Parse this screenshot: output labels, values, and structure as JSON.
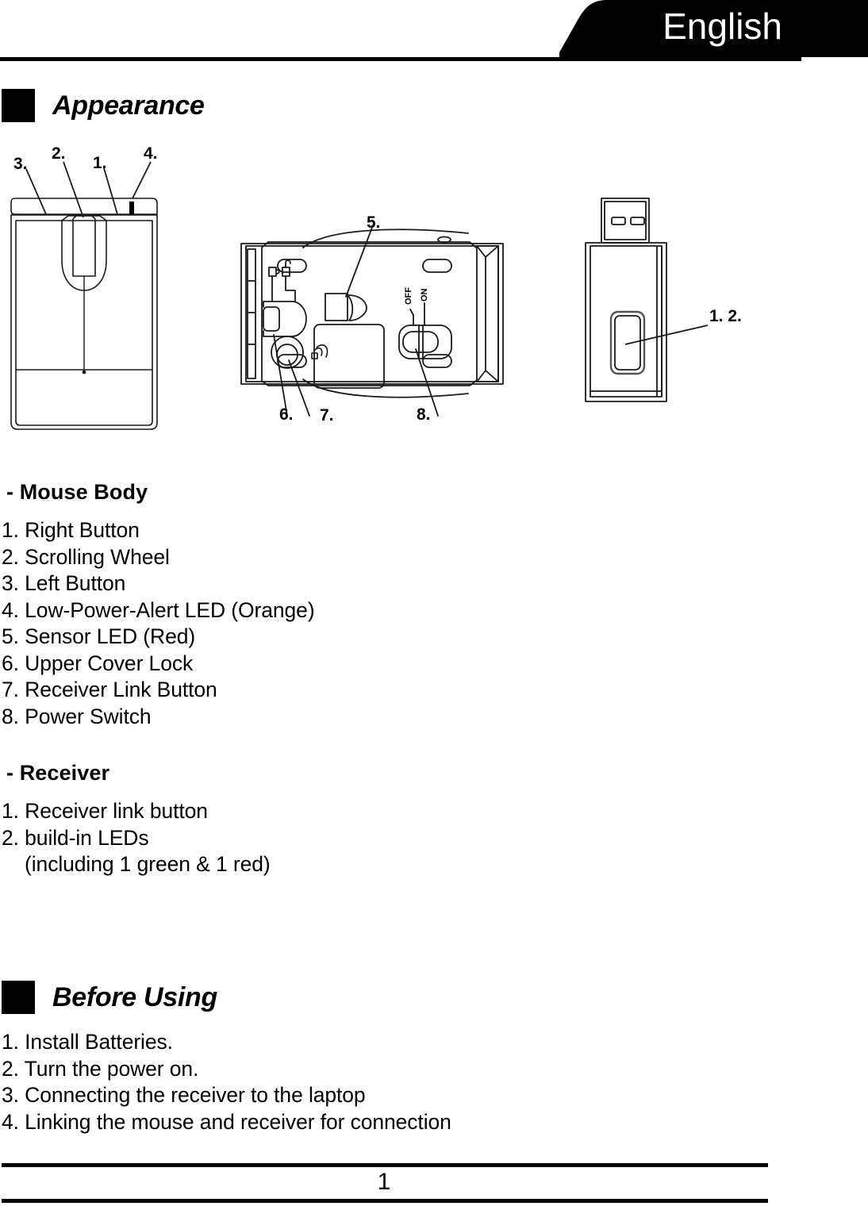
{
  "header": {
    "language_tab": "English"
  },
  "sections": [
    {
      "id": "appearance",
      "title": "Appearance"
    },
    {
      "id": "before-using",
      "title": "Before Using"
    }
  ],
  "mouse_body": {
    "heading": "- Mouse Body",
    "items": [
      "1. Right Button",
      "2. Scrolling Wheel",
      "3. Left Button",
      "4. Low-Power-Alert LED (Orange)",
      "5. Sensor LED (Red)",
      "6. Upper Cover Lock",
      "7. Receiver Link Button",
      "8. Power Switch"
    ]
  },
  "receiver": {
    "heading": "- Receiver",
    "items": [
      "1. Receiver link button",
      "2. build-in LEDs",
      "    (including 1 green & 1 red)"
    ]
  },
  "before_using": {
    "items": [
      "1. Install Batteries.",
      "2. Turn the power on.",
      "3. Connecting the receiver to the laptop",
      "4. Linking the mouse and receiver for connection"
    ]
  },
  "figures": {
    "mouse_top": {
      "callouts": [
        "3.",
        "2.",
        "1.",
        "4."
      ]
    },
    "mouse_bottom": {
      "callouts": [
        "5.",
        "6.",
        "7.",
        "8."
      ],
      "switch_labels": [
        "OFF",
        "ON"
      ]
    },
    "usb_receiver": {
      "callouts": [
        "1.  2."
      ]
    }
  },
  "footer": {
    "page_number": "1"
  },
  "colors": {
    "ink": "#000000",
    "paper": "#ffffff",
    "line": "#1a1a1a",
    "line_light": "#555555"
  }
}
